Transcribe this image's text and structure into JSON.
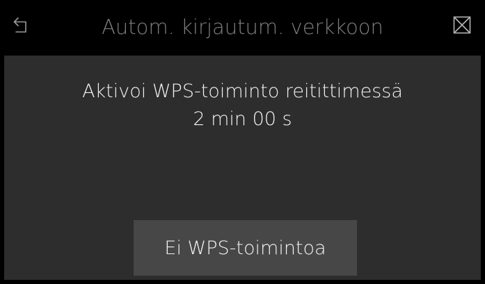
{
  "header": {
    "title": "Autom. kirjautum. verkkoon",
    "back_icon": "back-arrow-icon",
    "close_icon": "close-box-icon"
  },
  "main": {
    "instruction": "Aktivoi WPS-toiminto reitittimessä",
    "countdown": "2 min 00 s",
    "no_wps_button_label": "Ei WPS-toimintoa"
  },
  "colors": {
    "background": "#000000",
    "panel": "#2d2d2d",
    "button": "#474747",
    "title_text": "#7e7e7e",
    "text": "#f2f2f2"
  }
}
